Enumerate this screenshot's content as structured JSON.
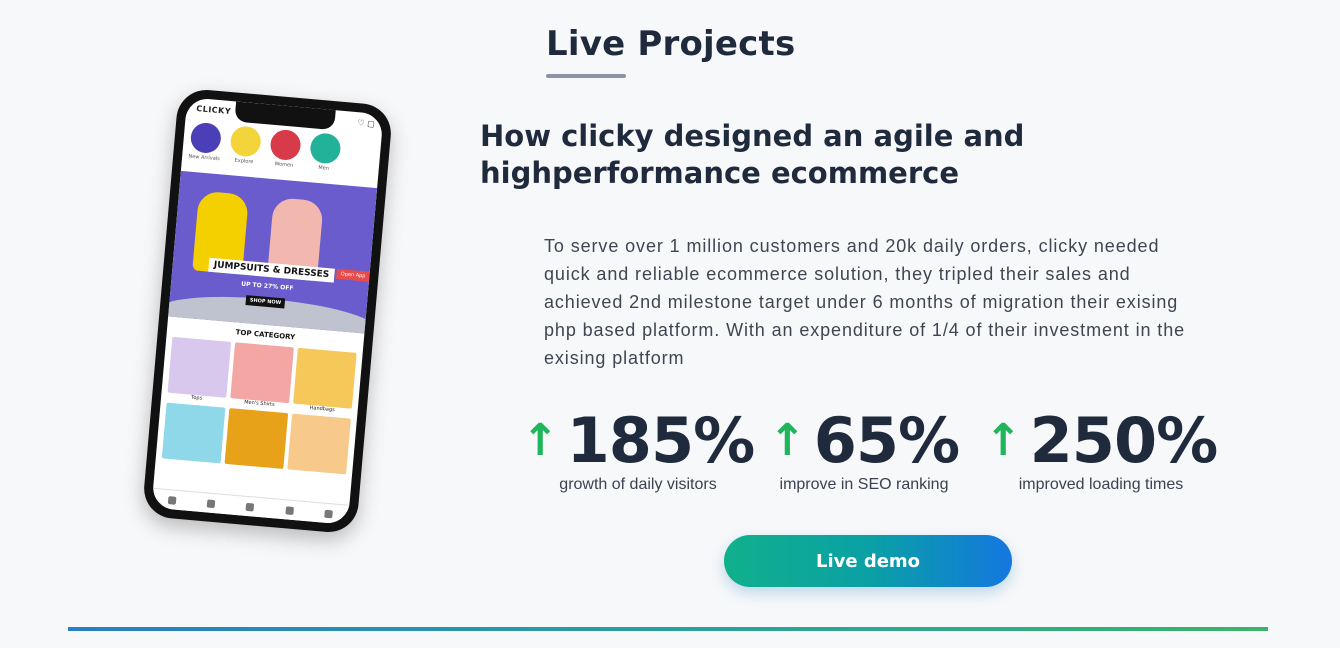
{
  "section": {
    "title": "Live Projects"
  },
  "project": {
    "headline": "How clicky designed an agile and highperformance ecommerce",
    "description": "To serve over 1 million customers and 20k daily orders, clicky needed quick and reliable ecommerce solution, they tripled their sales and achieved 2nd milestone target under 6 months of migration their exising php based platform. With an expenditure of 1/4 of their investment in the exising platform"
  },
  "stats": [
    {
      "arrow": "↑",
      "value": "185%",
      "label": "growth of daily visitors"
    },
    {
      "arrow": "↑",
      "value": "65%",
      "label": "improve in SEO ranking"
    },
    {
      "arrow": "↑",
      "value": "250%",
      "label": "improved loading times"
    }
  ],
  "cta": {
    "label": "Live demo"
  },
  "phone_mock": {
    "brand": "CLICKY",
    "categories": [
      "New Arrivals",
      "Explore",
      "Women",
      "Men"
    ],
    "banner_title": "JUMPSUITS & DRESSES",
    "banner_sub": "UP TO 27% OFF",
    "banner_button": "SHOP NOW",
    "banner_badge": "Open App",
    "top_category": "TOP CATEGORY",
    "tiles": [
      "Tops",
      "Men's Shirts",
      "Handbags"
    ]
  },
  "colors": {
    "accent_green": "#1fb55a",
    "button_gradient_start": "#10b08c",
    "button_gradient_end": "#1477e0",
    "heading": "#1f2a3c"
  }
}
